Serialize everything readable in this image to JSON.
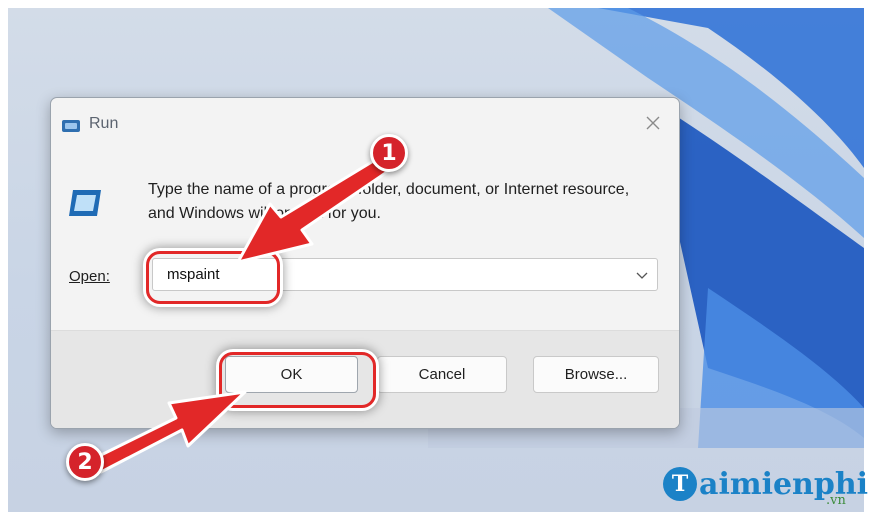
{
  "dialog": {
    "title": "Run",
    "description": "Type the name of a program, folder, document, or Internet resource, and Windows will open it for you.",
    "open_label": "Open:",
    "open_value": "mspaint",
    "buttons": {
      "ok": "OK",
      "cancel": "Cancel",
      "browse": "Browse..."
    }
  },
  "callouts": {
    "step1": "1",
    "step2": "2"
  },
  "watermark": {
    "logo_letter": "T",
    "name": "aimienphi",
    "suffix": ".vn"
  },
  "colors": {
    "callout_red": "#d5232b",
    "highlight_red": "#e22828",
    "wallpaper_blue": "#1f5fc5",
    "logo_blue": "#1b82c7"
  },
  "icons": [
    "run-app-icon",
    "close-icon",
    "run-program-icon",
    "chevron-down-icon"
  ]
}
